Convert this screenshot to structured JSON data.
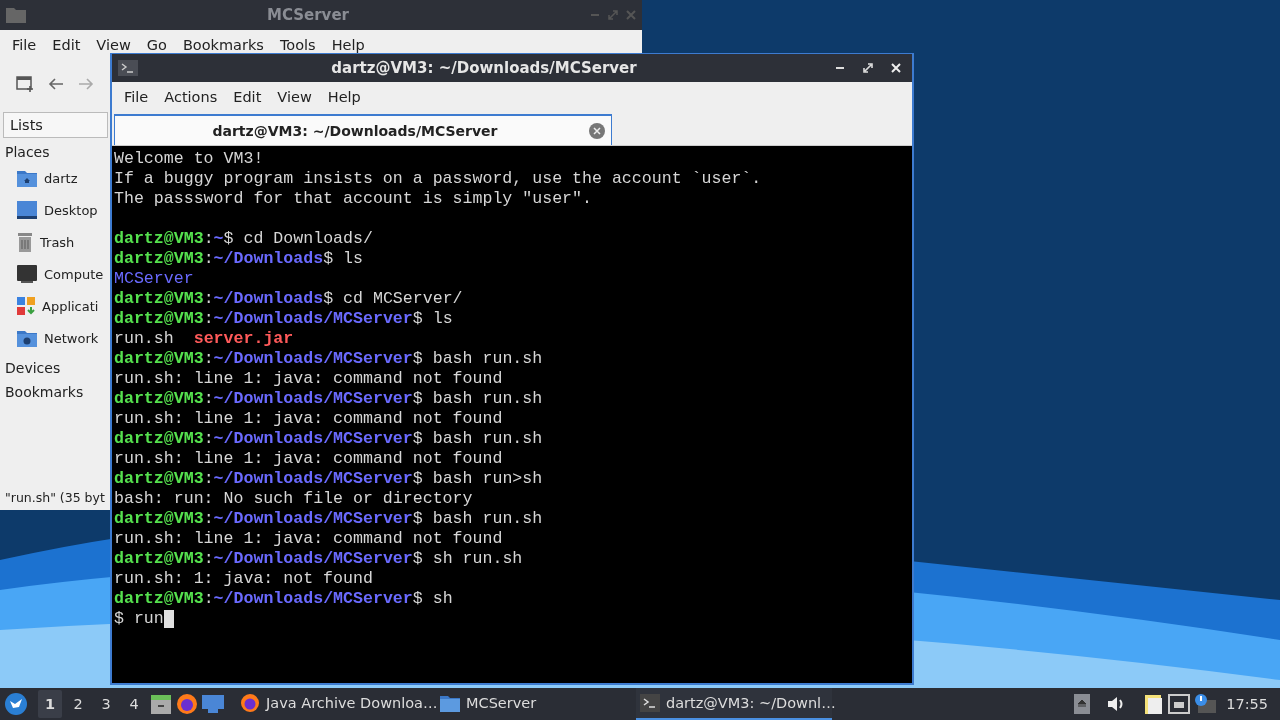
{
  "file_manager": {
    "title": "MCServer",
    "menu": [
      "File",
      "Edit",
      "View",
      "Go",
      "Bookmarks",
      "Tools",
      "Help"
    ],
    "sidebar_tab": "Lists",
    "sections": [
      {
        "label": "Places",
        "items": [
          {
            "label": "dartz",
            "kind": "home"
          },
          {
            "label": "Desktop",
            "kind": "desktop"
          },
          {
            "label": "Trash",
            "kind": "trash"
          },
          {
            "label": "Compute",
            "kind": "computer"
          },
          {
            "label": "Applicati",
            "kind": "apps"
          },
          {
            "label": "Network",
            "kind": "network"
          }
        ]
      },
      {
        "label": "Devices"
      },
      {
        "label": "Bookmarks"
      }
    ],
    "status": "\"run.sh\" (35 byt"
  },
  "terminal": {
    "title": "dartz@VM3: ~/Downloads/MCServer",
    "menu": [
      "File",
      "Actions",
      "Edit",
      "View",
      "Help"
    ],
    "tabs": [
      {
        "label": "dartz@VM3: ~/Downloads/MCServer",
        "selected": true
      }
    ],
    "lines": [
      {
        "kind": "text",
        "cursor": false,
        "segments": [
          {
            "text": "Welcome to VM3!",
            "kind": "plain"
          }
        ]
      },
      {
        "kind": "text",
        "cursor": false,
        "segments": [
          {
            "text": "If a buggy program insists on a password, use the account `user`.",
            "kind": "plain"
          }
        ]
      },
      {
        "kind": "text",
        "cursor": false,
        "segments": [
          {
            "text": "The passsword for that account is simply \"user\".",
            "kind": "plain"
          }
        ]
      },
      {
        "kind": "blank"
      },
      {
        "kind": "text",
        "cursor": false,
        "segments": [
          {
            "text": "dartz@VM3",
            "kind": "user"
          },
          {
            "text": ":",
            "kind": "plain"
          },
          {
            "text": "~",
            "kind": "path"
          },
          {
            "text": "$ cd Downloads/",
            "kind": "plain"
          }
        ]
      },
      {
        "kind": "text",
        "cursor": false,
        "segments": [
          {
            "text": "dartz@VM3",
            "kind": "user"
          },
          {
            "text": ":",
            "kind": "plain"
          },
          {
            "text": "~/Downloads",
            "kind": "path"
          },
          {
            "text": "$ ls",
            "kind": "plain"
          }
        ]
      },
      {
        "kind": "text",
        "cursor": false,
        "segments": [
          {
            "text": "MCServer",
            "kind": "directory"
          }
        ]
      },
      {
        "kind": "text",
        "cursor": false,
        "segments": [
          {
            "text": "dartz@VM3",
            "kind": "user"
          },
          {
            "text": ":",
            "kind": "plain"
          },
          {
            "text": "~/Downloads",
            "kind": "path"
          },
          {
            "text": "$ cd MCServer/",
            "kind": "plain"
          }
        ]
      },
      {
        "kind": "text",
        "cursor": false,
        "segments": [
          {
            "text": "dartz@VM3",
            "kind": "user"
          },
          {
            "text": ":",
            "kind": "plain"
          },
          {
            "text": "~/Downloads/MCServer",
            "kind": "path"
          },
          {
            "text": "$ ls",
            "kind": "plain"
          }
        ]
      },
      {
        "kind": "text",
        "cursor": false,
        "segments": [
          {
            "text": "run.sh  ",
            "kind": "plain"
          },
          {
            "text": "server.jar",
            "kind": "archive"
          }
        ]
      },
      {
        "kind": "text",
        "cursor": false,
        "segments": [
          {
            "text": "dartz@VM3",
            "kind": "user"
          },
          {
            "text": ":",
            "kind": "plain"
          },
          {
            "text": "~/Downloads/MCServer",
            "kind": "path"
          },
          {
            "text": "$ bash run.sh",
            "kind": "plain"
          }
        ]
      },
      {
        "kind": "text",
        "cursor": false,
        "segments": [
          {
            "text": "run.sh: line 1: java: command not found",
            "kind": "plain"
          }
        ]
      },
      {
        "kind": "text",
        "cursor": false,
        "segments": [
          {
            "text": "dartz@VM3",
            "kind": "user"
          },
          {
            "text": ":",
            "kind": "plain"
          },
          {
            "text": "~/Downloads/MCServer",
            "kind": "path"
          },
          {
            "text": "$ bash run.sh",
            "kind": "plain"
          }
        ]
      },
      {
        "kind": "text",
        "cursor": false,
        "segments": [
          {
            "text": "run.sh: line 1: java: command not found",
            "kind": "plain"
          }
        ]
      },
      {
        "kind": "text",
        "cursor": false,
        "segments": [
          {
            "text": "dartz@VM3",
            "kind": "user"
          },
          {
            "text": ":",
            "kind": "plain"
          },
          {
            "text": "~/Downloads/MCServer",
            "kind": "path"
          },
          {
            "text": "$ bash run.sh",
            "kind": "plain"
          }
        ]
      },
      {
        "kind": "text",
        "cursor": false,
        "segments": [
          {
            "text": "run.sh: line 1: java: command not found",
            "kind": "plain"
          }
        ]
      },
      {
        "kind": "text",
        "cursor": false,
        "segments": [
          {
            "text": "dartz@VM3",
            "kind": "user"
          },
          {
            "text": ":",
            "kind": "plain"
          },
          {
            "text": "~/Downloads/MCServer",
            "kind": "path"
          },
          {
            "text": "$ bash run>sh",
            "kind": "plain"
          }
        ]
      },
      {
        "kind": "text",
        "cursor": false,
        "segments": [
          {
            "text": "bash: run: No such file or directory",
            "kind": "plain"
          }
        ]
      },
      {
        "kind": "text",
        "cursor": false,
        "segments": [
          {
            "text": "dartz@VM3",
            "kind": "user"
          },
          {
            "text": ":",
            "kind": "plain"
          },
          {
            "text": "~/Downloads/MCServer",
            "kind": "path"
          },
          {
            "text": "$ bash run.sh",
            "kind": "plain"
          }
        ]
      },
      {
        "kind": "text",
        "cursor": false,
        "segments": [
          {
            "text": "run.sh: line 1: java: command not found",
            "kind": "plain"
          }
        ]
      },
      {
        "kind": "text",
        "cursor": false,
        "segments": [
          {
            "text": "dartz@VM3",
            "kind": "user"
          },
          {
            "text": ":",
            "kind": "plain"
          },
          {
            "text": "~/Downloads/MCServer",
            "kind": "path"
          },
          {
            "text": "$ sh run.sh",
            "kind": "plain"
          }
        ]
      },
      {
        "kind": "text",
        "cursor": false,
        "segments": [
          {
            "text": "run.sh: 1: java: not found",
            "kind": "plain"
          }
        ]
      },
      {
        "kind": "text",
        "cursor": false,
        "segments": [
          {
            "text": "dartz@VM3",
            "kind": "user"
          },
          {
            "text": ":",
            "kind": "plain"
          },
          {
            "text": "~/Downloads/MCServer",
            "kind": "path"
          },
          {
            "text": "$ sh",
            "kind": "plain"
          }
        ]
      },
      {
        "kind": "text",
        "cursor": true,
        "segments": [
          {
            "text": "$ run",
            "kind": "plain"
          }
        ]
      }
    ]
  },
  "taskbar": {
    "workspaces": [
      {
        "label": "1",
        "selected": true
      },
      {
        "label": "2",
        "selected": false
      },
      {
        "label": "3",
        "selected": false
      },
      {
        "label": "4",
        "selected": false
      }
    ],
    "tasks": [
      {
        "label": "Java Archive Downloa…",
        "kind": "browser",
        "selected": false
      },
      {
        "label": "MCServer",
        "kind": "folder",
        "selected": false
      },
      {
        "label": "dartz@VM3: ~/Downl…",
        "kind": "terminal",
        "selected": true
      }
    ],
    "clock": "17:55"
  }
}
